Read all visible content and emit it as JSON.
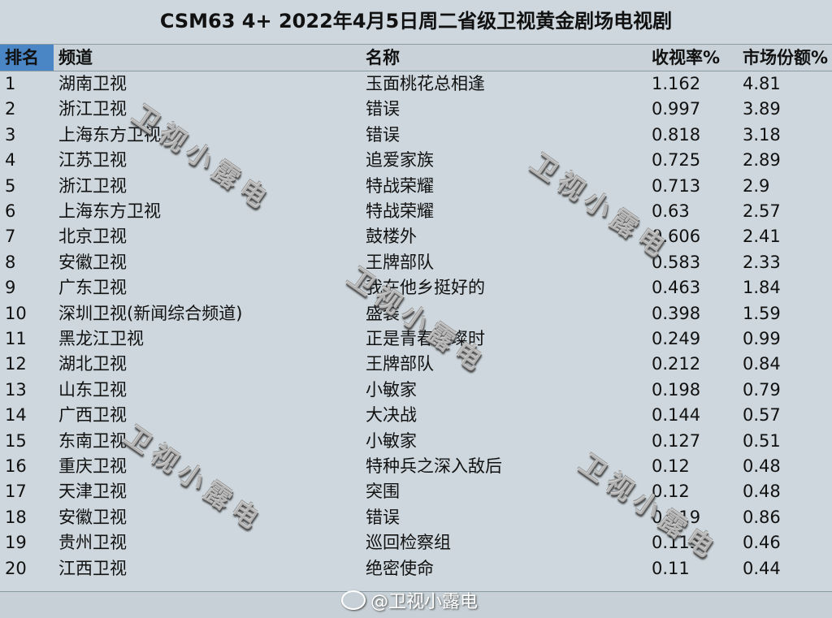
{
  "title": "CSM63 4+ 2022年4月5日周二省级卫视黄金剧场电视剧",
  "headers": {
    "rank": "排名",
    "channel": "频道",
    "name": "名称",
    "rating": "收视率%",
    "share": "市场份额%"
  },
  "rows": [
    {
      "rank": "1",
      "channel": "湖南卫视",
      "name": "玉面桃花总相逢",
      "rating": "1.162",
      "share": "4.81"
    },
    {
      "rank": "2",
      "channel": "浙江卫视",
      "name": "错误",
      "rating": "0.997",
      "share": "3.89"
    },
    {
      "rank": "3",
      "channel": "上海东方卫视",
      "name": "错误",
      "rating": "0.818",
      "share": "3.18"
    },
    {
      "rank": "4",
      "channel": "江苏卫视",
      "name": "追爱家族",
      "rating": "0.725",
      "share": "2.89"
    },
    {
      "rank": "5",
      "channel": "浙江卫视",
      "name": "特战荣耀",
      "rating": "0.713",
      "share": "2.9"
    },
    {
      "rank": "6",
      "channel": "上海东方卫视",
      "name": "特战荣耀",
      "rating": "0.63",
      "share": "2.57"
    },
    {
      "rank": "7",
      "channel": "北京卫视",
      "name": "鼓楼外",
      "rating": "0.606",
      "share": "2.41"
    },
    {
      "rank": "8",
      "channel": "安徽卫视",
      "name": "王牌部队",
      "rating": "0.583",
      "share": "2.33"
    },
    {
      "rank": "9",
      "channel": "广东卫视",
      "name": "我在他乡挺好的",
      "rating": "0.463",
      "share": "1.84"
    },
    {
      "rank": "10",
      "channel": "深圳卫视(新闻综合频道)",
      "name": "盛装",
      "rating": "0.398",
      "share": "1.59"
    },
    {
      "rank": "11",
      "channel": "黑龙江卫视",
      "name": "正是青春璀璨时",
      "rating": "0.249",
      "share": "0.99"
    },
    {
      "rank": "12",
      "channel": "湖北卫视",
      "name": "王牌部队",
      "rating": "0.212",
      "share": "0.84"
    },
    {
      "rank": "13",
      "channel": "山东卫视",
      "name": "小敏家",
      "rating": "0.198",
      "share": "0.79"
    },
    {
      "rank": "14",
      "channel": "广西卫视",
      "name": "大决战",
      "rating": "0.144",
      "share": "0.57"
    },
    {
      "rank": "15",
      "channel": "东南卫视",
      "name": "小敏家",
      "rating": "0.127",
      "share": "0.51"
    },
    {
      "rank": "16",
      "channel": "重庆卫视",
      "name": "特种兵之深入敌后",
      "rating": "0.12",
      "share": "0.48"
    },
    {
      "rank": "17",
      "channel": "天津卫视",
      "name": "突围",
      "rating": "0.12",
      "share": "0.48"
    },
    {
      "rank": "18",
      "channel": "安徽卫视",
      "name": "错误",
      "rating": "0.119",
      "share": "0.86"
    },
    {
      "rank": "19",
      "channel": "贵州卫视",
      "name": "巡回检察组",
      "rating": "0.115",
      "share": "0.46"
    },
    {
      "rank": "20",
      "channel": "江西卫视",
      "name": "绝密使命",
      "rating": "0.11",
      "share": "0.44"
    }
  ],
  "watermark": "卫视小露电",
  "signature": "@卫视小露电"
}
